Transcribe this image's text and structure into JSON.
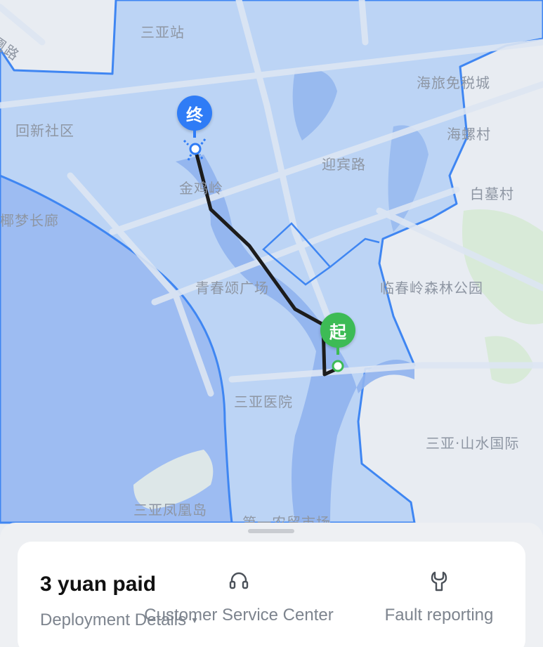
{
  "map": {
    "labels": [
      "三亚站",
      "凰路",
      "海旅免税城",
      "回新社区",
      "海螺村",
      "迎宾路",
      "金鸡岭",
      "白墓村",
      "椰梦长廊",
      "青春颂广场",
      "临春岭森林公园",
      "三亚医院",
      "三亚·山水国际",
      "三亚凤凰岛",
      "第一农贸市场"
    ],
    "end_marker": "终",
    "start_marker": "起",
    "colors": {
      "end_marker": "#2f7cf6",
      "start_marker": "#3dbb55",
      "route": "#1c1c1c",
      "zone_border": "#3f86f2",
      "zone_fill": "#bcd4f5",
      "sea": "#9dbcf2"
    }
  },
  "panel": {
    "paid_status": "3 yuan paid",
    "details_link": "Deployment Details",
    "details_caret_icon": "chevron-down-icon",
    "customer_service": {
      "icon": "headset-icon",
      "label": "Customer Service Center"
    },
    "fault_reporting": {
      "icon": "wrench-icon",
      "label": "Fault reporting"
    }
  }
}
